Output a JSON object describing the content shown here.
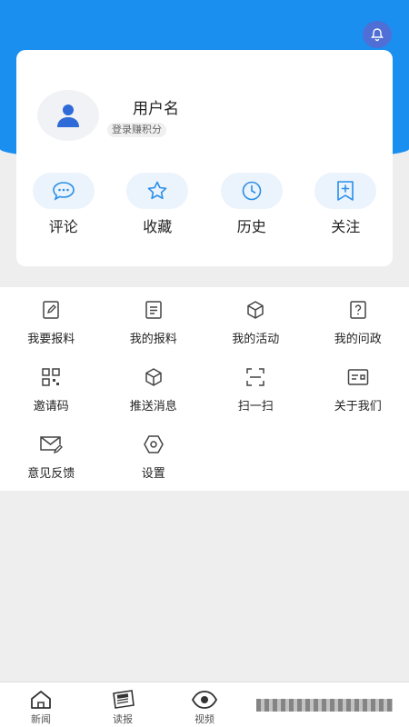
{
  "header": {
    "notification_icon": "bell-icon",
    "accent_color": "#1a8ff0"
  },
  "profile": {
    "username": "用户名",
    "login_hint": "登录赚积分",
    "avatar_icon": "person-icon"
  },
  "quick_actions": [
    {
      "label": "评论",
      "icon": "comment-icon"
    },
    {
      "label": "收藏",
      "icon": "star-icon"
    },
    {
      "label": "历史",
      "icon": "clock-icon"
    },
    {
      "label": "关注",
      "icon": "bookmark-plus-icon"
    }
  ],
  "menu": [
    {
      "label": "我要报料",
      "icon": "edit-doc-icon"
    },
    {
      "label": "我的报料",
      "icon": "doc-icon"
    },
    {
      "label": "我的活动",
      "icon": "cube-icon"
    },
    {
      "label": "我的问政",
      "icon": "question-doc-icon"
    },
    {
      "label": "邀请码",
      "icon": "qr-code-icon"
    },
    {
      "label": "推送消息",
      "icon": "cube-icon"
    },
    {
      "label": "扫一扫",
      "icon": "scan-icon"
    },
    {
      "label": "关于我们",
      "icon": "id-card-icon"
    },
    {
      "label": "意见反馈",
      "icon": "mail-edit-icon"
    },
    {
      "label": "设置",
      "icon": "hexagon-settings-icon"
    }
  ],
  "tab_bar": [
    {
      "label": "新闻",
      "icon": "home-icon"
    },
    {
      "label": "读报",
      "icon": "newspaper-icon"
    },
    {
      "label": "视频",
      "icon": "eye-icon"
    }
  ]
}
